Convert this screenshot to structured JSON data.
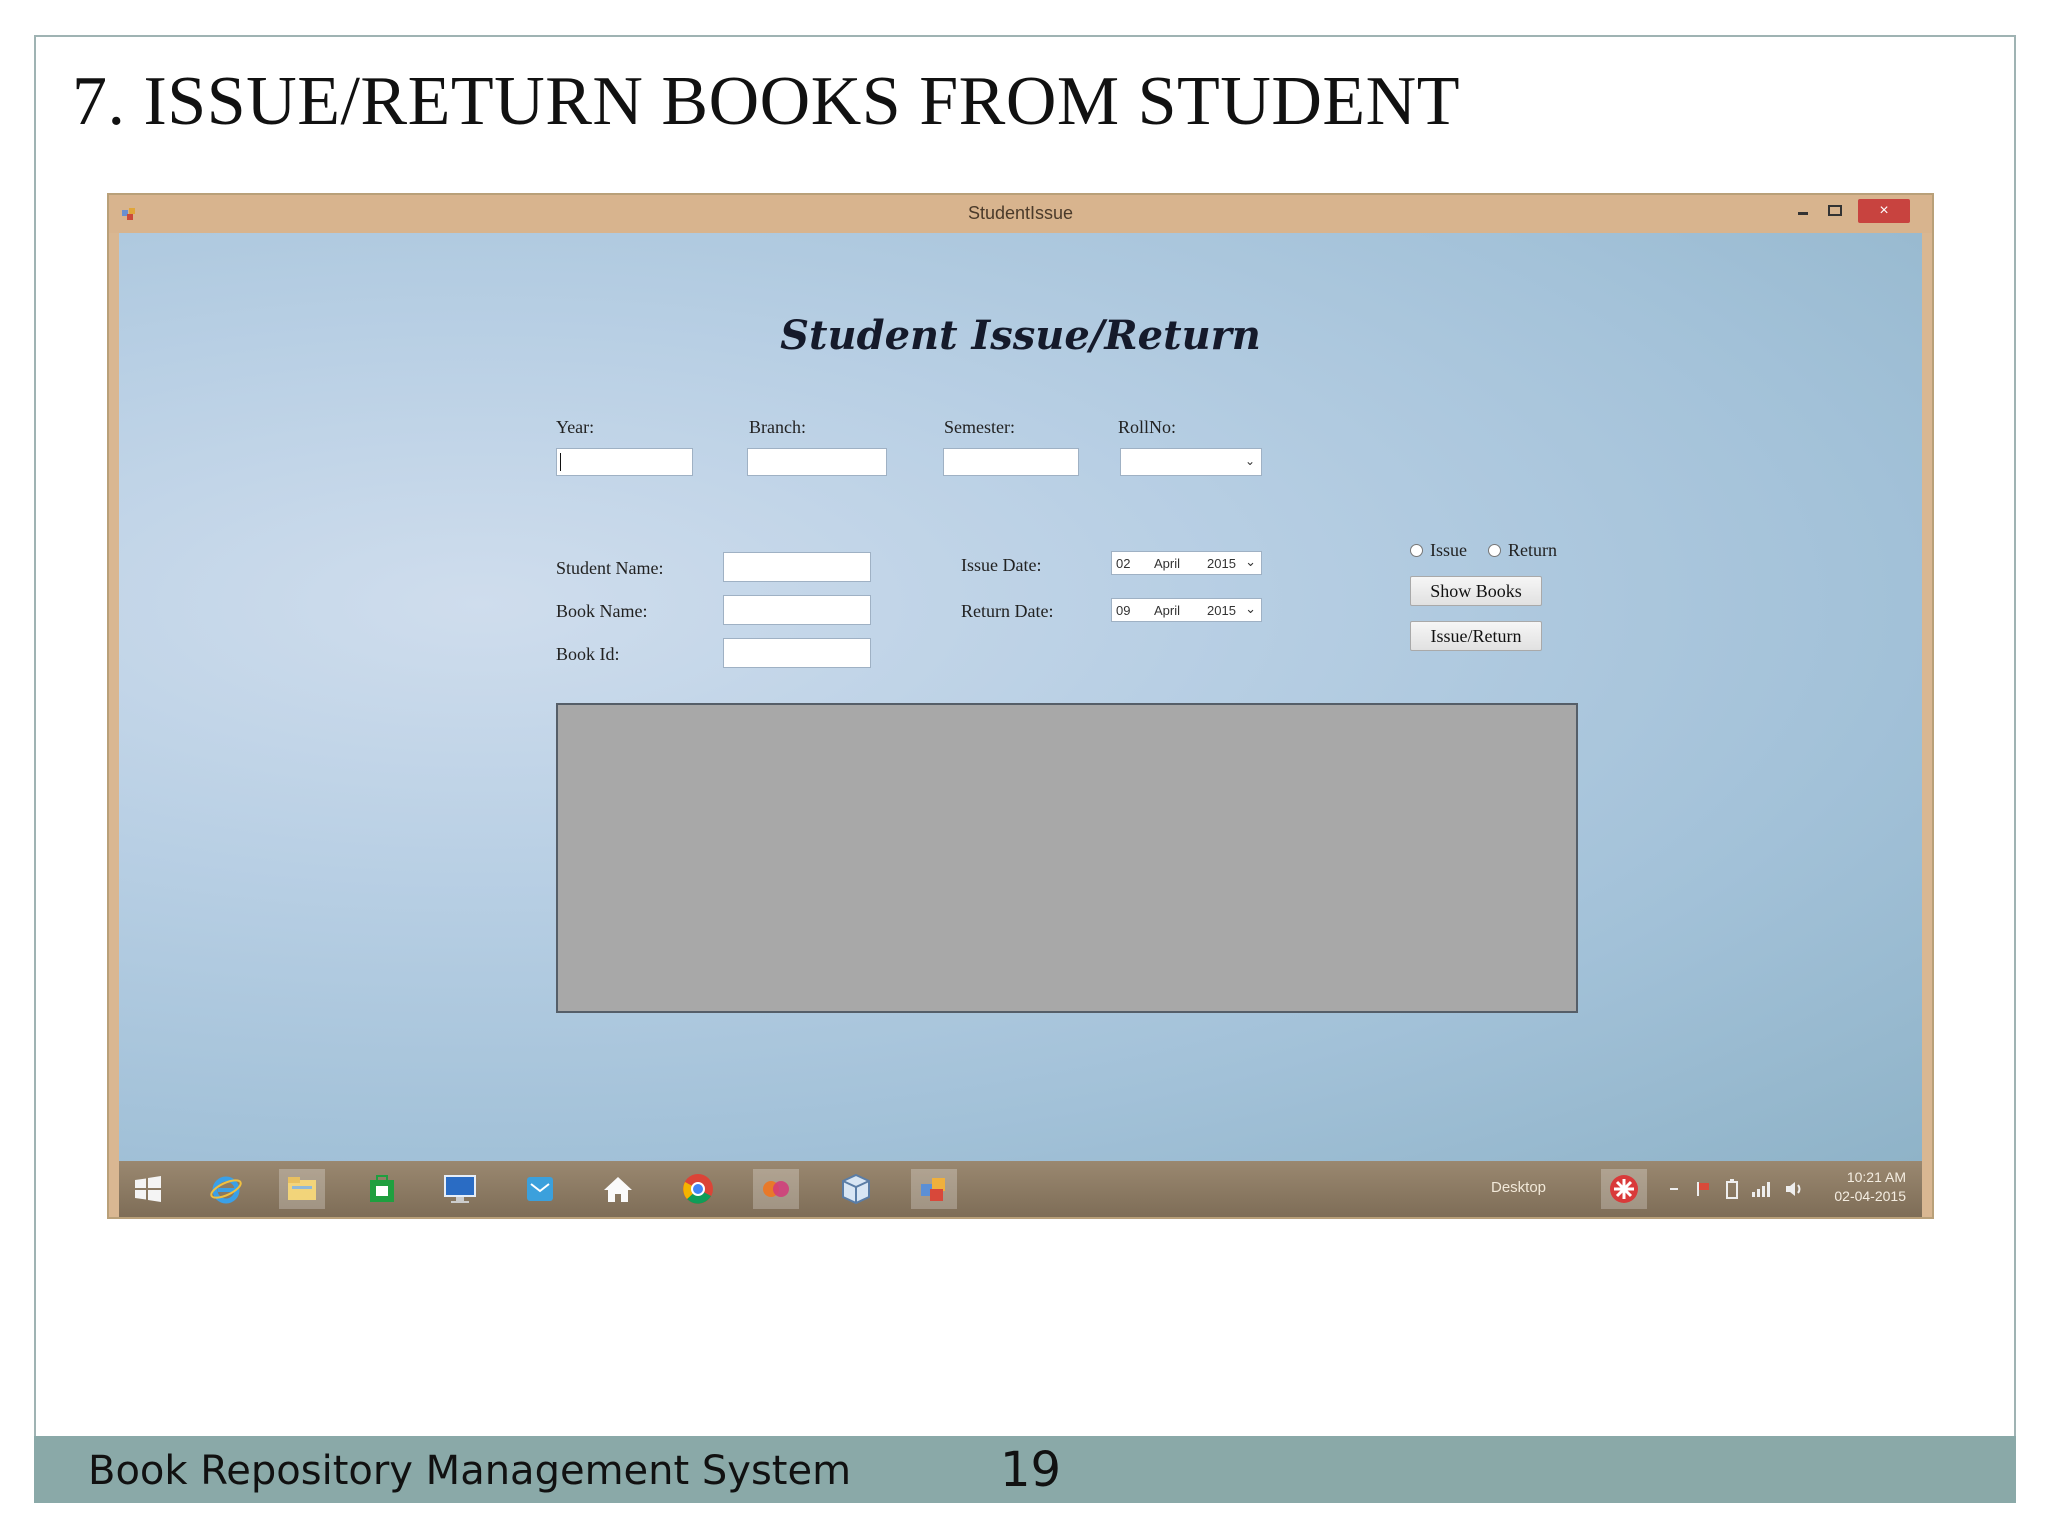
{
  "slide": {
    "title": "7. ISSUE/RETURN BOOKS FROM STUDENT",
    "footer_text": "Book Repository Management System",
    "page_number": "19"
  },
  "window": {
    "title": "StudentIssue",
    "close_glyph": "×"
  },
  "form": {
    "heading": "Student Issue/Return",
    "year_label": "Year:",
    "branch_label": "Branch:",
    "semester_label": "Semester:",
    "rollno_label": "RollNo:",
    "student_name_label": "Student Name:",
    "book_name_label": "Book Name:",
    "book_id_label": "Book Id:",
    "issue_date_label": "Issue Date:",
    "return_date_label": "Return Date:",
    "issue_date": {
      "day": "02",
      "month": "April",
      "year": "2015"
    },
    "return_date": {
      "day": "09",
      "month": "April",
      "year": "2015"
    },
    "radio_issue_label": "Issue",
    "radio_return_label": "Return",
    "show_books_button": "Show Books",
    "issue_return_button": "Issue/Return"
  },
  "taskbar": {
    "desktop_label": "Desktop",
    "time": "10:21 AM",
    "date": "02-04-2015",
    "icons": [
      "windows-start-icon",
      "internet-explorer-icon",
      "file-explorer-icon",
      "store-icon",
      "monitor-icon",
      "mail-icon",
      "home-icon",
      "chrome-icon",
      "media-icon",
      "cube-icon",
      "form-app-icon"
    ]
  },
  "colors": {
    "footer_bar": "#8aa9a8",
    "window_frame": "#d8b48e",
    "close_button": "#c8433f",
    "grid_background": "#a8a8a8"
  }
}
